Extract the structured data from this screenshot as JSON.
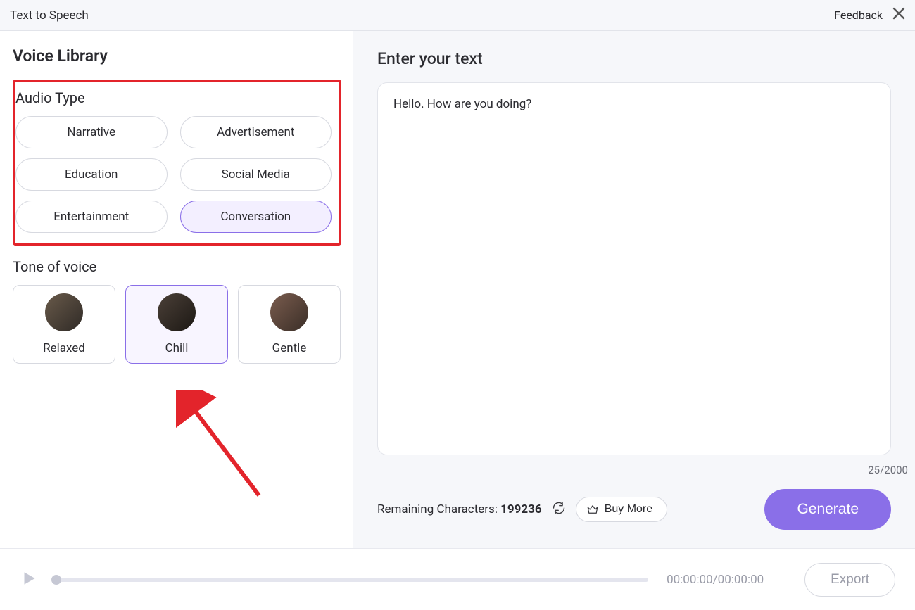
{
  "header": {
    "title": "Text to Speech",
    "feedback": "Feedback"
  },
  "sidebar": {
    "title": "Voice Library",
    "audio_type_label": "Audio Type",
    "audio_types": {
      "narrative": "Narrative",
      "advertisement": "Advertisement",
      "education": "Education",
      "social_media": "Social Media",
      "entertainment": "Entertainment",
      "conversation": "Conversation"
    },
    "selected_audio_type": "conversation",
    "tone_label": "Tone of voice",
    "tones": {
      "relaxed": "Relaxed",
      "chill": "Chill",
      "gentle": "Gentle"
    },
    "selected_tone": "chill"
  },
  "content": {
    "heading": "Enter your text",
    "text_value": "Hello. How are you doing?",
    "char_counter": "25/2000",
    "remaining_label": "Remaining Characters: ",
    "remaining_count": "199236",
    "buy_more": "Buy More",
    "generate": "Generate"
  },
  "player": {
    "time": "00:00:00/00:00:00",
    "export": "Export"
  }
}
